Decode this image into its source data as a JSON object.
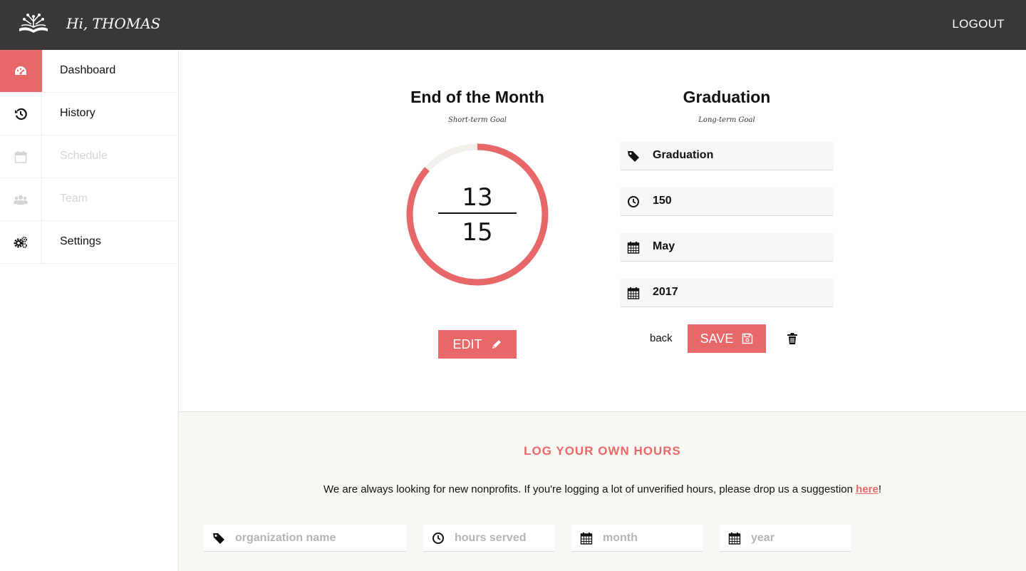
{
  "header": {
    "greeting": "Hi, THOMAS",
    "logout": "LOGOUT"
  },
  "sidebar": {
    "items": [
      {
        "label": "Dashboard",
        "icon": "dashboard-icon",
        "state": "active"
      },
      {
        "label": "History",
        "icon": "history-icon",
        "state": "normal"
      },
      {
        "label": "Schedule",
        "icon": "calendar-icon",
        "state": "disabled"
      },
      {
        "label": "Team",
        "icon": "users-icon",
        "state": "disabled"
      },
      {
        "label": "Settings",
        "icon": "gears-icon",
        "state": "normal"
      }
    ]
  },
  "short_goal": {
    "title": "End of the Month",
    "subtitle": "Short-term Goal",
    "completed": "13",
    "target": "15",
    "edit_label": "EDIT"
  },
  "long_goal": {
    "title": "Graduation",
    "subtitle": "Long-term Goal",
    "fields": {
      "name": "Graduation",
      "hours": "150",
      "month": "May",
      "year": "2017"
    },
    "back_label": "back",
    "save_label": "SAVE"
  },
  "log_hours": {
    "title": "LOG YOUR OWN HOURS",
    "text_before": "We are always looking for new nonprofits. If you're logging a lot of unverified hours, please drop us a suggestion ",
    "link": "here",
    "text_after": "!",
    "placeholders": {
      "organization": "organization name",
      "hours": "hours served",
      "month": "month",
      "year": "year"
    }
  },
  "colors": {
    "accent": "#e8686a",
    "topbar": "#383838",
    "ring_track": "#f3f0ec"
  }
}
